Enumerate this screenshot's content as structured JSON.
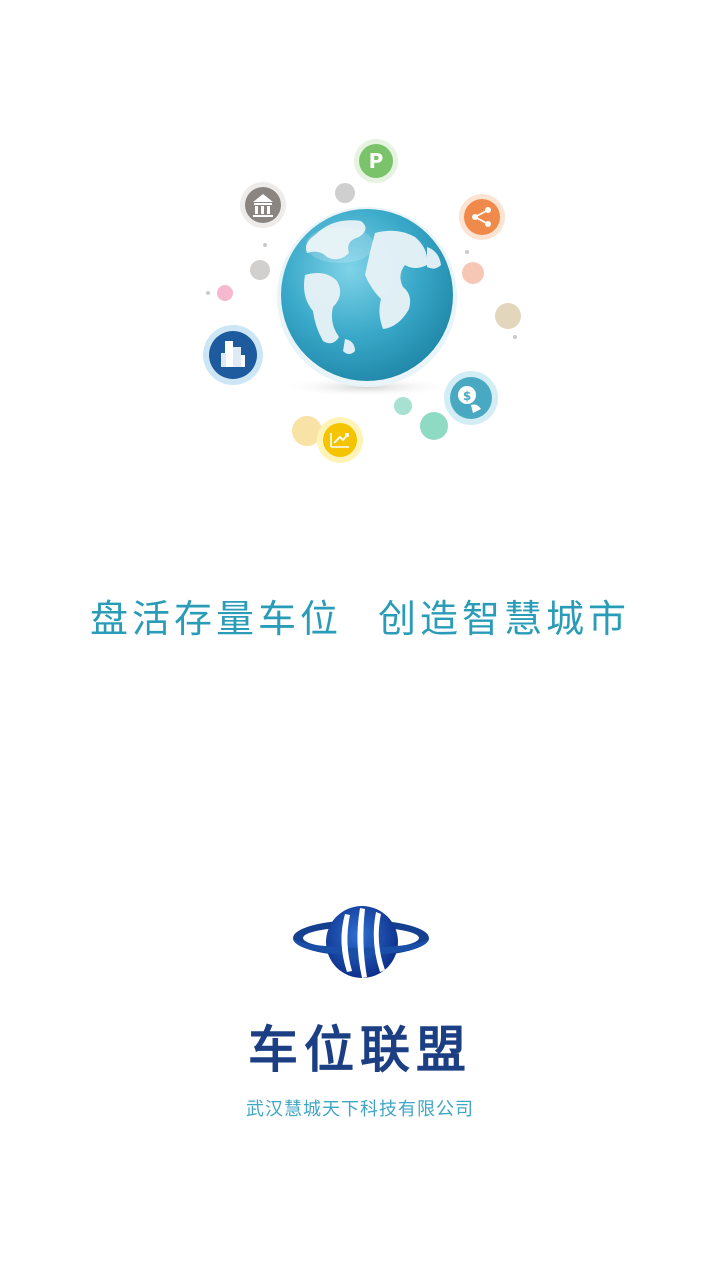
{
  "hero": {
    "icons": [
      {
        "name": "parking-icon",
        "color": "#7bc36b"
      },
      {
        "name": "bank-icon",
        "color": "#8a8580"
      },
      {
        "name": "share-icon",
        "color": "#f08a4b"
      },
      {
        "name": "buildings-icon",
        "color": "#2c6fb5"
      },
      {
        "name": "dollar-icon",
        "color": "#4aa9c2"
      },
      {
        "name": "chart-up-icon",
        "color": "#f5c400"
      }
    ]
  },
  "slogan": {
    "part1": "盘活存量车位",
    "part2": "创造智慧城市"
  },
  "brand": {
    "name": "车位联盟"
  },
  "company": {
    "name": "武汉慧城天下科技有限公司"
  },
  "colors": {
    "accent": "#2a9cb8",
    "brand": "#1b3f82",
    "company": "#3fa6c4"
  }
}
